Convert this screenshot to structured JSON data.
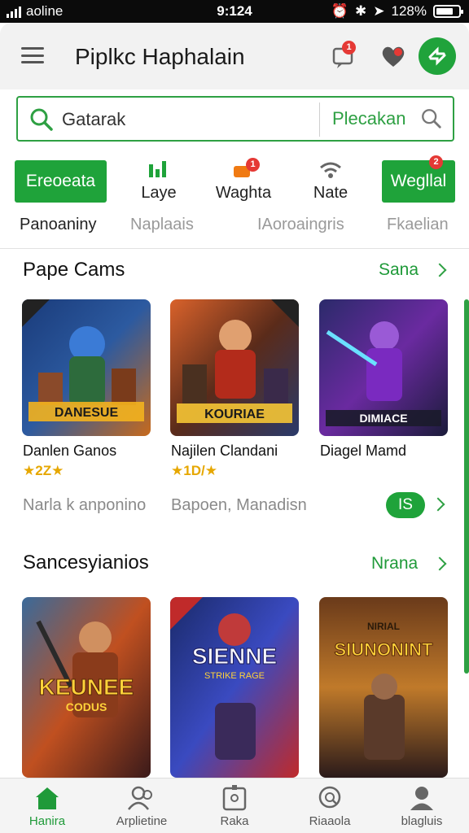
{
  "status_bar": {
    "carrier": "aoline",
    "time": "9:124",
    "battery": "128%"
  },
  "header": {
    "title": "Piplkc Haphalain",
    "message_badge": "1"
  },
  "search": {
    "value": "Gatarak",
    "action": "Plecakan"
  },
  "categories": [
    {
      "label": "Ereoeata",
      "style": "button"
    },
    {
      "label": "Laye"
    },
    {
      "label": "Waghta",
      "badge": "1"
    },
    {
      "label": "Nate"
    },
    {
      "label": "Wegllal",
      "style": "button",
      "badge": "2"
    }
  ],
  "sub_tabs": [
    "Panoaniny",
    "Naplaais",
    "IAoroaingris",
    "Fkaelian"
  ],
  "section1": {
    "title": "Pape Cams",
    "more": "Sana",
    "games": [
      {
        "name": "Danlen Ganos",
        "rating": "★2Z★",
        "cover_text": "DANESUE"
      },
      {
        "name": "Najilen Clandani",
        "rating": "★1D/★",
        "cover_text": "KOURIAE"
      },
      {
        "name": "Diagel Mamd",
        "rating": "",
        "cover_text": "DIMIACE"
      }
    ],
    "developers": [
      "Narla k anponino",
      "Bapoen, Manadisn"
    ],
    "pill": "IS"
  },
  "section2": {
    "title": "Sancesyianios",
    "more": "Nrana",
    "games": [
      {
        "cover_text": "KEUNEE",
        "cover_sub": "CODUS"
      },
      {
        "cover_text": "SIENNE",
        "cover_sub": "STRIKE RAGE"
      },
      {
        "cover_text": "SIUNONINT",
        "cover_sub": "NIRIAL"
      }
    ]
  },
  "bottom_nav": [
    {
      "label": "Hanira",
      "icon": "home-icon",
      "active": true
    },
    {
      "label": "Arplietine",
      "icon": "people-icon"
    },
    {
      "label": "Raka",
      "icon": "gift-icon"
    },
    {
      "label": "Riaaola",
      "icon": "search-circle-icon"
    },
    {
      "label": "blagluis",
      "icon": "profile-icon"
    }
  ],
  "colors": {
    "accent": "#1fa33a",
    "badge": "#e53935",
    "rating": "#e6a700"
  }
}
